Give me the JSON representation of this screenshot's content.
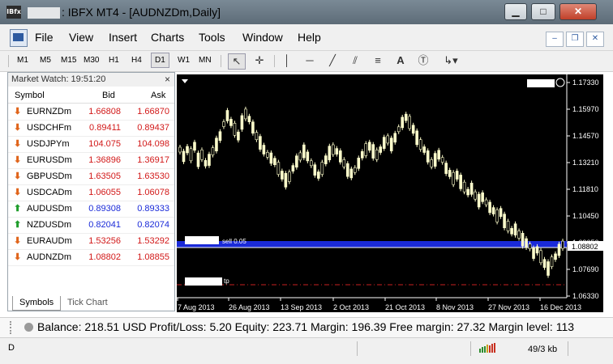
{
  "window": {
    "title": ": IBFX MT4 - [AUDNZDm,Daily]",
    "app_icon_text": "IBfx",
    "controls": [
      "minimize-icon",
      "maximize-icon",
      "close-icon"
    ]
  },
  "menu": {
    "items": [
      "File",
      "View",
      "Insert",
      "Charts",
      "Tools",
      "Window",
      "Help"
    ]
  },
  "toolbar": {
    "timeframes": [
      "M1",
      "M5",
      "M15",
      "M30",
      "H1",
      "H4",
      "D1",
      "W1",
      "MN"
    ],
    "active_timeframe": "D1",
    "badge": "4"
  },
  "market_watch": {
    "title": "Market Watch: 19:51:20",
    "columns": [
      "Symbol",
      "Bid",
      "Ask"
    ],
    "rows": [
      {
        "symbol": "EURNZDm",
        "bid": "1.66808",
        "ask": "1.66870",
        "dir": "down"
      },
      {
        "symbol": "USDCHFm",
        "bid": "0.89411",
        "ask": "0.89437",
        "dir": "down"
      },
      {
        "symbol": "USDJPYm",
        "bid": "104.075",
        "ask": "104.098",
        "dir": "down"
      },
      {
        "symbol": "EURUSDm",
        "bid": "1.36896",
        "ask": "1.36917",
        "dir": "down"
      },
      {
        "symbol": "GBPUSDm",
        "bid": "1.63505",
        "ask": "1.63530",
        "dir": "down"
      },
      {
        "symbol": "USDCADm",
        "bid": "1.06055",
        "ask": "1.06078",
        "dir": "down"
      },
      {
        "symbol": "AUDUSDm",
        "bid": "0.89308",
        "ask": "0.89333",
        "dir": "up"
      },
      {
        "symbol": "NZDUSDm",
        "bid": "0.82041",
        "ask": "0.82074",
        "dir": "up"
      },
      {
        "symbol": "EURAUDm",
        "bid": "1.53256",
        "ask": "1.53292",
        "dir": "down"
      },
      {
        "symbol": "AUDNZDm",
        "bid": "1.08802",
        "ask": "1.08855",
        "dir": "down"
      }
    ],
    "tabs": [
      "Symbols",
      "Tick Chart"
    ],
    "selected_tab": "Symbols"
  },
  "chart": {
    "symbol": "AUDNZDm",
    "timeframe": "Daily",
    "price_labels": [
      "1.17330",
      "1.15970",
      "1.14570",
      "1.13210",
      "1.11810",
      "1.10450",
      "1.09050",
      "1.08802",
      "1.07690",
      "1.06330"
    ],
    "current_price": "1.08802",
    "date_labels": [
      "7 Aug 2013",
      "26 Aug 2013",
      "13 Sep 2013",
      "2 Oct 2013",
      "21 Oct 2013",
      "8 Nov 2013",
      "27 Nov 2013",
      "16 Dec 2013"
    ],
    "order_line_label": "sell 0.05",
    "tp_line_label": "tp",
    "colors": {
      "background": "#000000",
      "candle": "#ffffcc",
      "order_band": "#1a2ad8",
      "tp_line": "#c82020",
      "price_line": "#ffffff"
    }
  },
  "status": {
    "account": "Balance: 218.51 USD  Profit/Loss: 5.20  Equity: 223.71  Margin: 196.39  Free margin: 27.32  Margin level: 113"
  },
  "bottom": {
    "left": "D",
    "traffic": "49/3 kb"
  }
}
